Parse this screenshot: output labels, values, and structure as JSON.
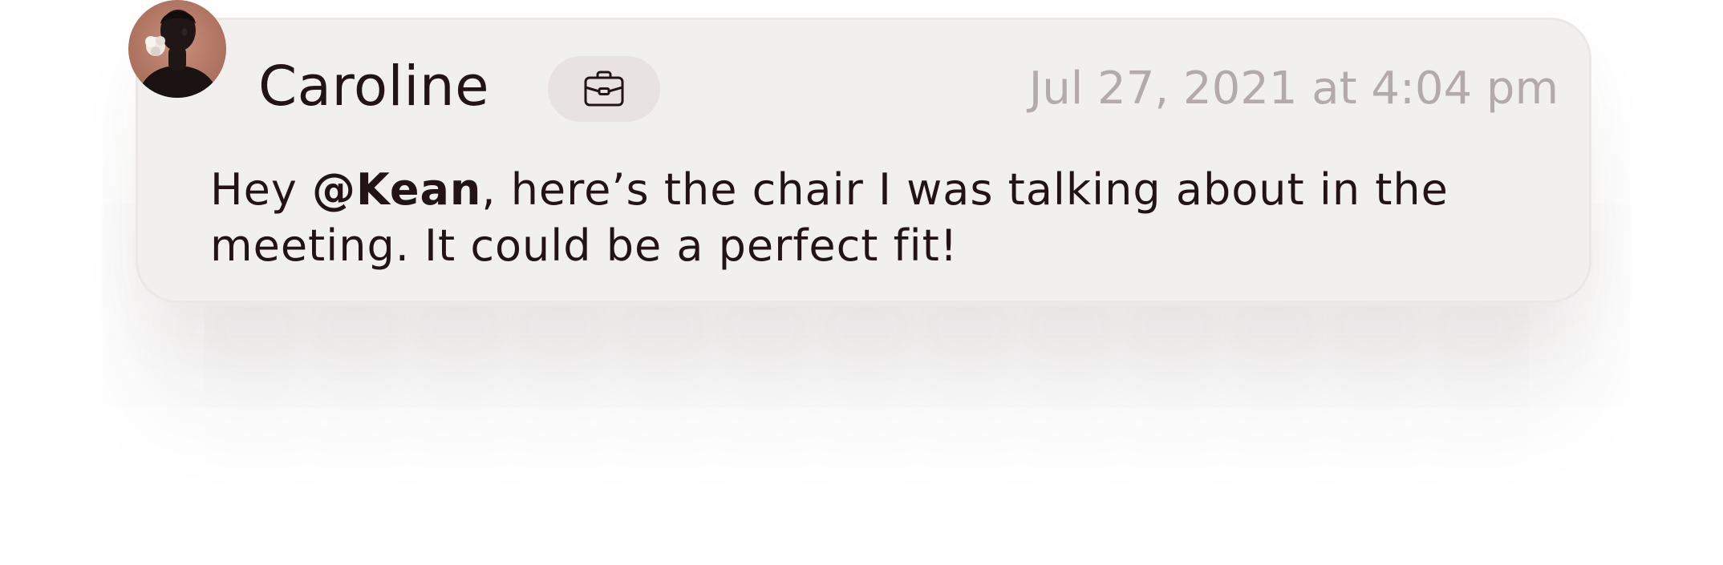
{
  "comment": {
    "author": "Caroline",
    "badge_icon": "briefcase-icon",
    "timestamp": "Jul 27, 2021 at 4:04 pm",
    "message": {
      "before": "Hey ",
      "mention": "@Kean",
      "after": ", here’s the chair I was talking about in the meeting. It could be a perfect fit!"
    }
  },
  "colors": {
    "card_background": "#f2f0ef",
    "text_primary": "#221416",
    "text_muted": "#b4aaa9",
    "badge_background": "#e8e3e1",
    "avatar_background": "#b07462"
  }
}
